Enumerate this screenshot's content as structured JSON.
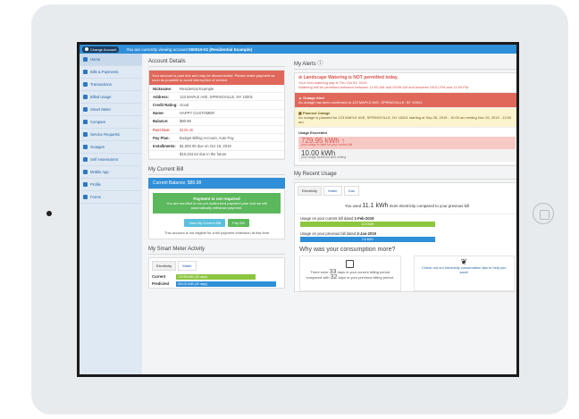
{
  "topbar": {
    "change_account_label": "Change Account",
    "message_prefix": "You are currently viewing account",
    "account_name": "000010-01 (Residential Example)"
  },
  "sidebar": {
    "items": [
      {
        "label": "Home",
        "icon": "home-icon"
      },
      {
        "label": "Bills & Payments",
        "icon": "dollar-icon"
      },
      {
        "label": "Transactions",
        "icon": "list-icon"
      },
      {
        "label": "Billed Usage",
        "icon": "bar-chart-icon"
      },
      {
        "label": "Smart Meter",
        "icon": "line-chart-icon"
      },
      {
        "label": "Compare",
        "icon": "compare-icon"
      },
      {
        "label": "Service Requests",
        "icon": "wrench-icon"
      },
      {
        "label": "Outages",
        "icon": "warning-icon"
      },
      {
        "label": "Self Assessment",
        "icon": "clipboard-icon"
      },
      {
        "label": "Mobile App",
        "icon": "mobile-icon"
      },
      {
        "label": "Profile",
        "icon": "user-icon"
      },
      {
        "label": "Forms",
        "icon": "forms-icon"
      }
    ]
  },
  "account_details": {
    "title": "Account Details",
    "alert": "Your account is past due and may be disconnected. Please make payment as soon as possible to avoid interruption of service.",
    "rows": [
      {
        "k": "Nickname:",
        "v": "Residential Example"
      },
      {
        "k": "Address:",
        "v": "123 MAPLE AVE, SPRINGVILLE, NY 10001"
      },
      {
        "k": "Credit Rating:",
        "v": "Good"
      },
      {
        "k": "Name:",
        "v": "HAPPY CUSTOMER"
      },
      {
        "k": "Balance:",
        "v": "$80.98"
      },
      {
        "k": "Past Due:",
        "v": "$125.45"
      },
      {
        "k": "Pay Plan:",
        "v": "Budget Billing Account, Auto Pay"
      },
      {
        "k": "Installments:",
        "v": "$1,000.00 due on Oct 19, 2019"
      },
      {
        "k": "",
        "v": "$19,334.54 due in the future"
      }
    ]
  },
  "current_bill": {
    "title": "My Current Bill",
    "balance_label": "Current Balance: $80.98",
    "not_required_title": "Payment is not required",
    "not_required_body": "You are enrolled in our pre-authorized payment plan and we will automatically withdraw payment.",
    "view_button": "View My Current Bill",
    "pay_button": "Pay Bill",
    "note": "This account is not eligible for a bill payment extension at this time"
  },
  "smart_meter": {
    "title": "My Smart Meter Activity",
    "tabs": [
      "Electricity",
      "Water"
    ],
    "rows": [
      {
        "label": "Current",
        "bar": "729.95 kWh (30 days)",
        "color": "#8cc63f",
        "fill": 0.75
      },
      {
        "label": "Predicted",
        "bar": "900.00 kWh (30 days)",
        "color": "#2f8fd8",
        "fill": 0.95
      }
    ]
  },
  "alerts": {
    "title": "My Alerts",
    "watering_title": "Landscape Watering is NOT permitted today.",
    "watering_line1": "Your next watering day is Thu Oct 03, 2019.",
    "watering_line2": "Watering will be permitted between between 12:00 AM and 09:59 AM and between 08:01 PM and 11:59 PM.",
    "outage_title": "Outage Alert",
    "outage_body": "An outage has been confirmed at 123 MAPLE AVE, SPRINGVILLE, NY 10001.",
    "planned_title": "Planned Outage",
    "planned_body": "An outage is planned for 123 MAPLE AVE, SPRINGVILLE, NY 10001 starting at Sep 26, 2019 - 10:00 am ending Nov 26, 2019 - 12:00 am.",
    "usage_title": "Usage Exceeded",
    "usage_value": "729.95 kWh",
    "usage_sub": "your usage to date for your current bill",
    "threshold_value": "10.00 kWh",
    "threshold_sub": "your usage threshold alert setting"
  },
  "recent_usage": {
    "title": "My Recent Usage",
    "tabs": [
      "Electricity",
      "Water",
      "Gas"
    ],
    "used_prefix": "You used",
    "used_amount": "11.1 kWh",
    "used_suffix": "more electricity compared to your previous bill",
    "current_label": "Usage on your current bill dated",
    "current_date": "1-Feb-2019",
    "current_bar": "13.6 kWh",
    "previous_label": "Usage on your previous bill dated",
    "previous_date": "2-Jan-2019",
    "previous_bar": "2.5 kWh",
    "why_title": "Why was your consumption more?",
    "card1_a": "There were",
    "card1_days": "33",
    "card1_b": "days in your current billing period compared with",
    "card1_days2": "32",
    "card1_c": "days in your previous billing period.",
    "card2": "Check out our electricity conservation tips to help you save!"
  }
}
